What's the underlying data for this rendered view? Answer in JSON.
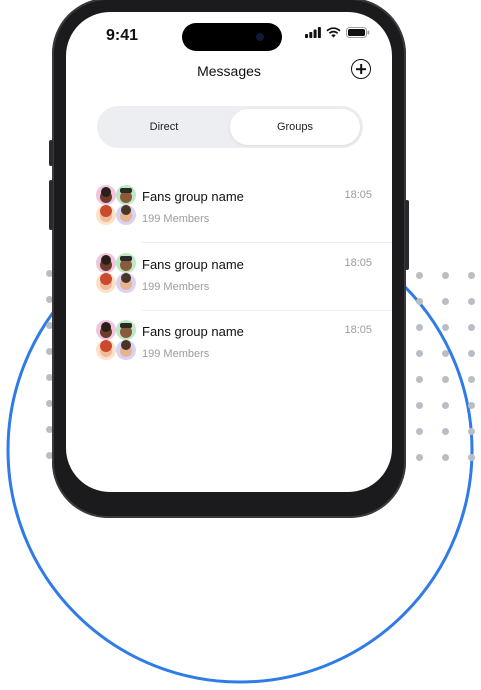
{
  "status": {
    "time": "9:41"
  },
  "header": {
    "title": "Messages",
    "add_icon": "plus-circle-icon"
  },
  "tabs": [
    {
      "label": "Direct",
      "selected": false
    },
    {
      "label": "Groups",
      "selected": true
    }
  ],
  "groups": [
    {
      "name": "Fans group name",
      "members": "199 Members",
      "time": "18:05"
    },
    {
      "name": "Fans group name",
      "members": "199 Members",
      "time": "18:05"
    },
    {
      "name": "Fans group name",
      "members": "199 Members",
      "time": "18:05"
    }
  ],
  "colors": {
    "accent_ring": "#2f7be8",
    "segment_bg": "#eceef2",
    "phone_frame": "#1b1b1d",
    "secondary_text": "#9a9ca1"
  }
}
